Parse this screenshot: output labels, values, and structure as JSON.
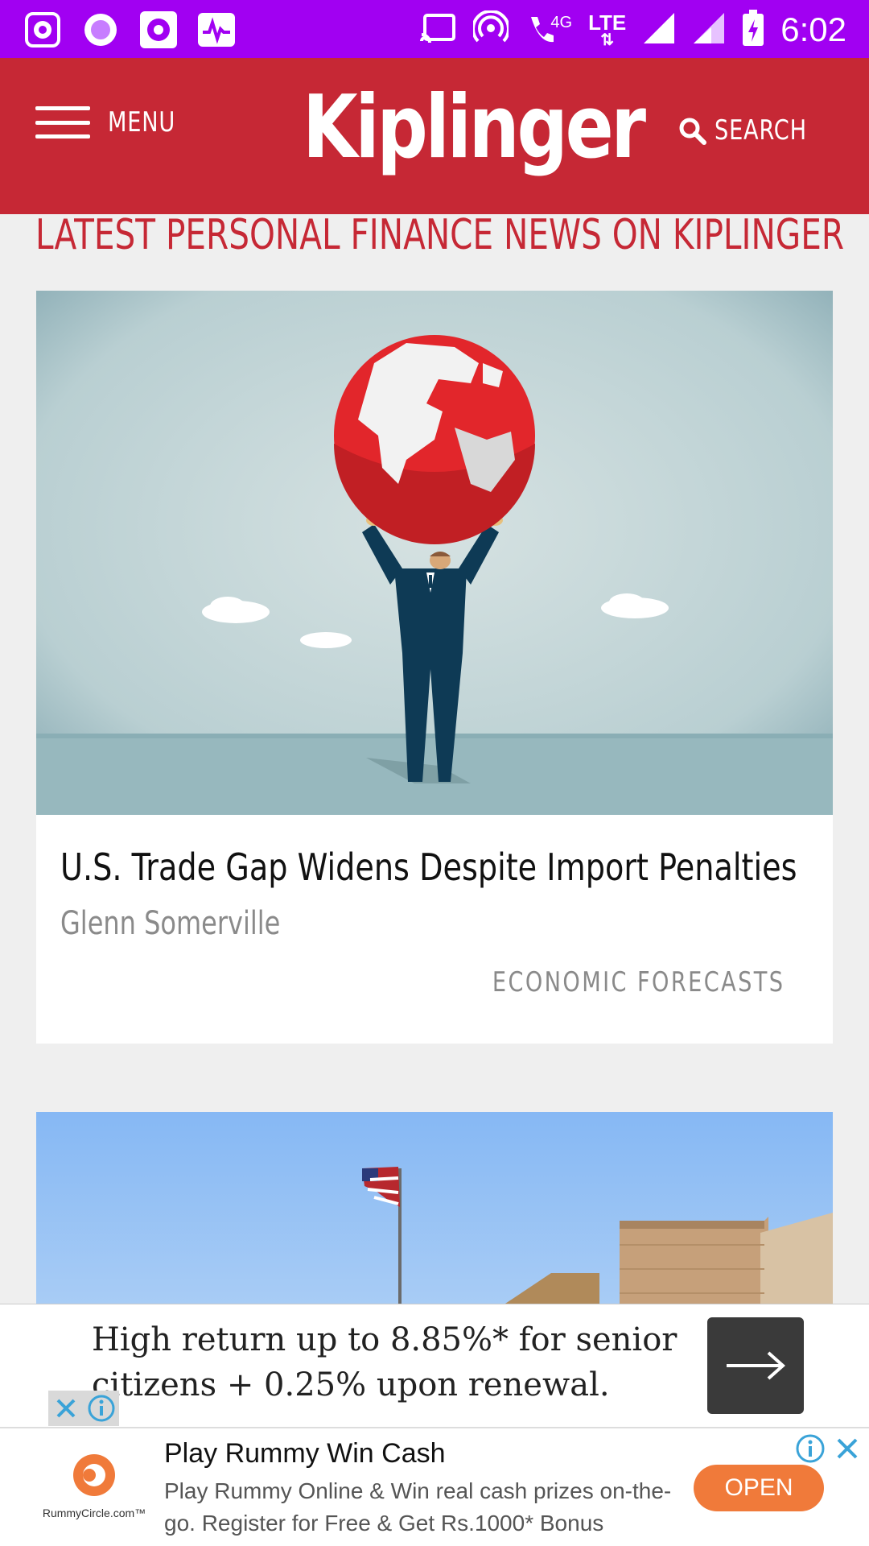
{
  "status_bar": {
    "time": "6:02",
    "network_type": "LTE",
    "network_gen": "4G",
    "color": "#a100f2"
  },
  "header": {
    "menu_label": "MENU",
    "logo": "Kiplinger",
    "search_label": "SEARCH",
    "color": "#c62835"
  },
  "section": {
    "title": "LATEST PERSONAL FINANCE NEWS ON KIPLINGER"
  },
  "articles": [
    {
      "headline": "U.S. Trade Gap Widens Despite Import Penalties",
      "author": "Glenn Somerville",
      "category": "ECONOMIC FORECASTS",
      "image_icon": "globe-illustration"
    },
    {
      "image_icon": "flag-building-photo"
    }
  ],
  "banner_ad": {
    "text": "High return up to 8.85%* for senior citizens + 0.25% upon renewal."
  },
  "bottom_ad": {
    "logo_text": "RummyCircle.com™",
    "title": "Play Rummy Win Cash",
    "description": "Play Rummy Online & Win real cash prizes on-the-go. Register for Free & Get Rs.1000* Bonus",
    "button_label": "OPEN",
    "button_color": "#f07a3a"
  }
}
